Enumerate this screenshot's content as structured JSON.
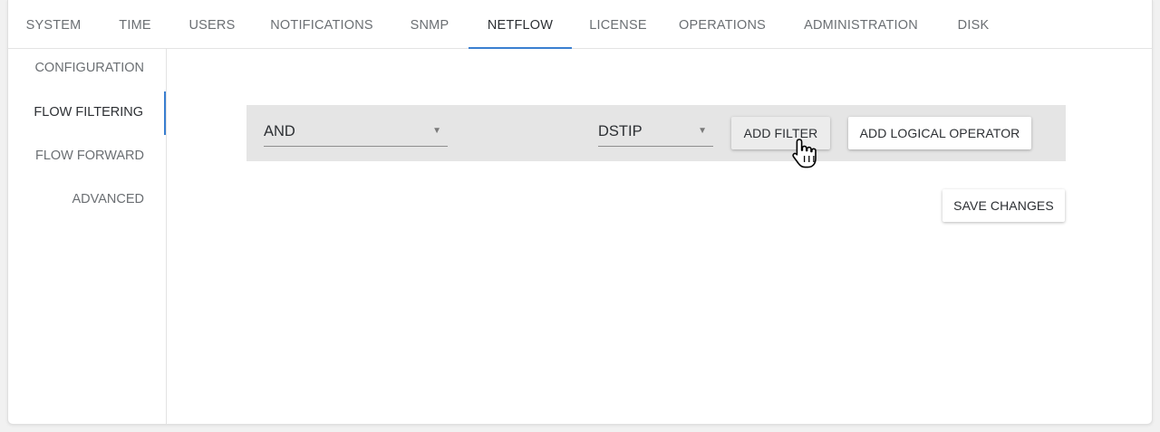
{
  "tabs": [
    {
      "label": "SYSTEM",
      "active": false
    },
    {
      "label": "TIME",
      "active": false
    },
    {
      "label": "USERS",
      "active": false
    },
    {
      "label": "NOTIFICATIONS",
      "active": false
    },
    {
      "label": "SNMP",
      "active": false
    },
    {
      "label": "NETFLOW",
      "active": true
    },
    {
      "label": "LICENSE",
      "active": false
    },
    {
      "label": "OPERATIONS",
      "active": false
    },
    {
      "label": "ADMINISTRATION",
      "active": false
    },
    {
      "label": "DISK",
      "active": false
    }
  ],
  "sidebar": {
    "items": [
      {
        "label": "CONFIGURATION",
        "active": false
      },
      {
        "label": "FLOW FILTERING",
        "active": true
      },
      {
        "label": "FLOW FORWARD",
        "active": false
      },
      {
        "label": "ADVANCED",
        "active": false
      }
    ]
  },
  "filter": {
    "operator_value": "AND",
    "field_value": "DSTIP",
    "add_filter_label": "ADD FILTER",
    "add_logical_operator_label": "ADD LOGICAL OPERATOR"
  },
  "actions": {
    "save_changes_label": "SAVE CHANGES"
  },
  "icons": {
    "caret": "caret-down-icon",
    "cursor": "hand-pointer-cursor"
  },
  "colors": {
    "accent": "#3a7fd0",
    "filter_bar_bg": "#e5e5e5",
    "text_muted": "#6b6f73",
    "text_active": "#2c2f33"
  }
}
